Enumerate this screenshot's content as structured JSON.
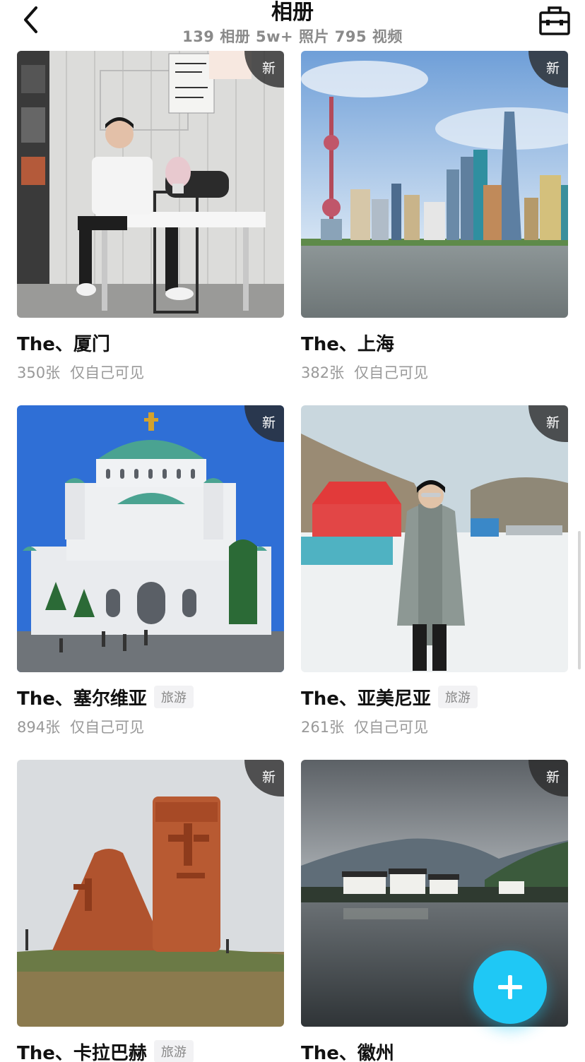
{
  "header": {
    "title": "相册",
    "subtitle": "139 相册 5w+ 照片 795 视频"
  },
  "albums": [
    {
      "name": "The、厦门",
      "count": "350张",
      "visibility": "仅自己可见",
      "tag": "",
      "badge": "新"
    },
    {
      "name": "The、上海",
      "count": "382张",
      "visibility": "仅自己可见",
      "tag": "",
      "badge": "新"
    },
    {
      "name": "The、塞尔维亚",
      "count": "894张",
      "visibility": "仅自己可见",
      "tag": "旅游",
      "badge": "新"
    },
    {
      "name": "The、亚美尼亚",
      "count": "261张",
      "visibility": "仅自己可见",
      "tag": "旅游",
      "badge": "新"
    },
    {
      "name": "The、卡拉巴赫",
      "count": "",
      "visibility": "",
      "tag": "旅游",
      "badge": "新"
    },
    {
      "name": "The、徽州",
      "count": "",
      "visibility": "",
      "tag": "",
      "badge": "新"
    }
  ],
  "icons": {
    "back": "chevron-left-icon",
    "toolbox": "toolbox-icon",
    "add": "plus-icon"
  },
  "colors": {
    "accent": "#1fc8f5",
    "badge_bg": "#282828",
    "muted_text": "#999999"
  }
}
